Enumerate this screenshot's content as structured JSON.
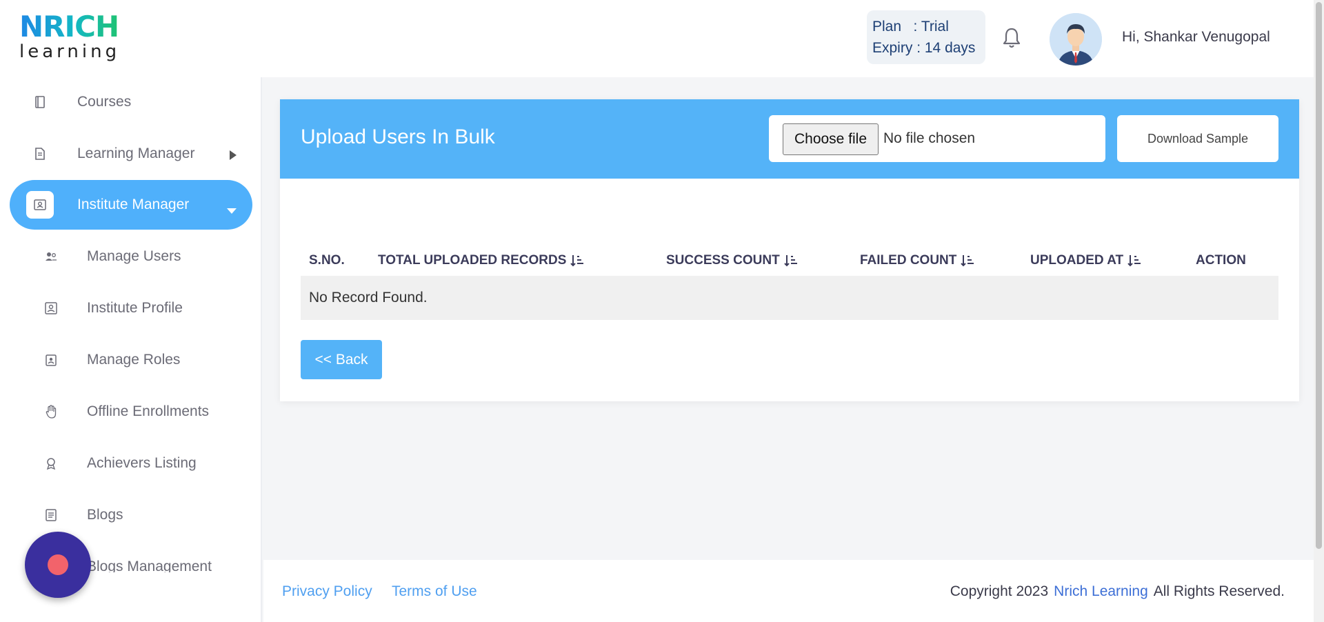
{
  "logo": {
    "top": "NRICH",
    "bottom": "learning"
  },
  "header": {
    "plan_label": "Plan",
    "plan_value": ": Trial",
    "expiry_label": "Expiry",
    "expiry_value": ": 14 days",
    "greeting": "Hi, Shankar Venugopal"
  },
  "sidebar": {
    "items": [
      {
        "label": "Courses",
        "icon": "book-icon"
      },
      {
        "label": "Learning Manager",
        "icon": "document-icon",
        "caret": "right"
      },
      {
        "label": "Institute Manager",
        "icon": "id-card-icon",
        "caret": "down",
        "active": true
      },
      {
        "label": "Manage Users",
        "icon": "users-icon"
      },
      {
        "label": "Institute Profile",
        "icon": "profile-icon"
      },
      {
        "label": "Manage Roles",
        "icon": "badge-icon"
      },
      {
        "label": "Offline Enrollments",
        "icon": "hand-icon"
      },
      {
        "label": "Achievers Listing",
        "icon": "award-icon"
      },
      {
        "label": "Blogs",
        "icon": "blog-icon"
      },
      {
        "label": "Blogs Management",
        "icon": "blog-manage-icon"
      }
    ]
  },
  "upload": {
    "title": "Upload Users In Bulk",
    "choose_file": "Choose file",
    "no_file": "No file chosen",
    "download_sample": "Download Sample"
  },
  "table": {
    "columns": [
      "S.NO.",
      "TOTAL UPLOADED RECORDS",
      "SUCCESS COUNT",
      "FAILED COUNT",
      "UPLOADED AT",
      "ACTION"
    ],
    "empty_message": "No Record Found."
  },
  "back_label": "<< Back",
  "footer": {
    "privacy": "Privacy Policy",
    "terms": "Terms of Use",
    "copyright": "Copyright 2023",
    "brand": "Nrich Learning",
    "rights": "All Rights Reserved."
  },
  "colors": {
    "accent": "#54b3f8",
    "sidebar_active": "#4fb0fb",
    "fab": "#3a2f9e",
    "fab_dot": "#f2636b",
    "link": "#4f9ff0"
  }
}
